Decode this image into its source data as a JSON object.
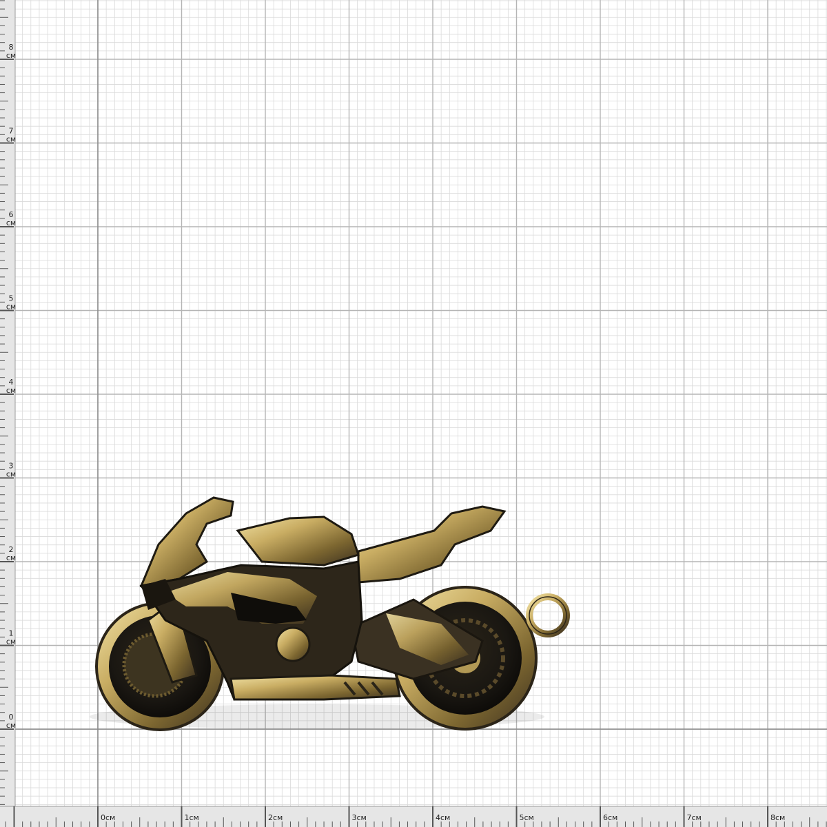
{
  "ruler": {
    "unit": "см",
    "bottom_labels": [
      "0см",
      "1см",
      "2см",
      "3см",
      "4см",
      "5см",
      "6см",
      "7см",
      "8см"
    ],
    "left_numbers": [
      "0",
      "1",
      "2",
      "3",
      "4",
      "5",
      "6",
      "7",
      "8"
    ],
    "left_unit": "см"
  },
  "colors": {
    "grid_major": "#b5b5b5",
    "grid_minor": "#dadada",
    "ruler_bg": "#e6e6e6",
    "brass_light": "#e9d79a",
    "brass_mid": "#b39a54",
    "brass_dark": "#3a3122",
    "shadow": "#141210"
  },
  "object": {
    "description_icon": "motorcycle-pendant-icon"
  }
}
